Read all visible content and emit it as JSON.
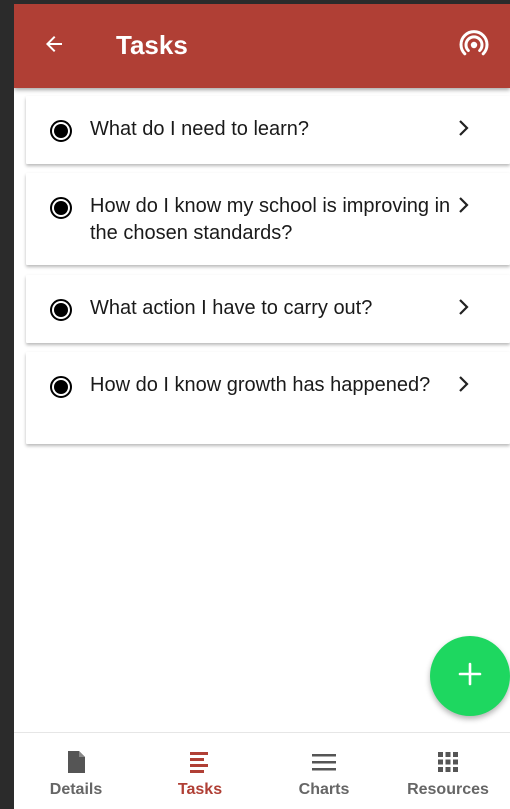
{
  "appbar": {
    "title": "Tasks",
    "back_icon": "arrow-left-icon",
    "action_icon": "broadcast-icon",
    "color": "#b03f35"
  },
  "tasks": [
    {
      "label": "What do I need to learn?"
    },
    {
      "label": "How do I know my school is improving in the chosen standards?"
    },
    {
      "label": "What action I have to carry out?"
    },
    {
      "label": "How do I know growth has happened?"
    }
  ],
  "fab": {
    "icon": "plus-icon",
    "color": "#1ed760"
  },
  "bottom_nav": [
    {
      "label": "Details",
      "icon": "document-icon",
      "active": false
    },
    {
      "label": "Tasks",
      "icon": "tasks-list-icon",
      "active": true
    },
    {
      "label": "Charts",
      "icon": "menu-lines-icon",
      "active": false
    },
    {
      "label": "Resources",
      "icon": "grid-icon",
      "active": false
    }
  ]
}
